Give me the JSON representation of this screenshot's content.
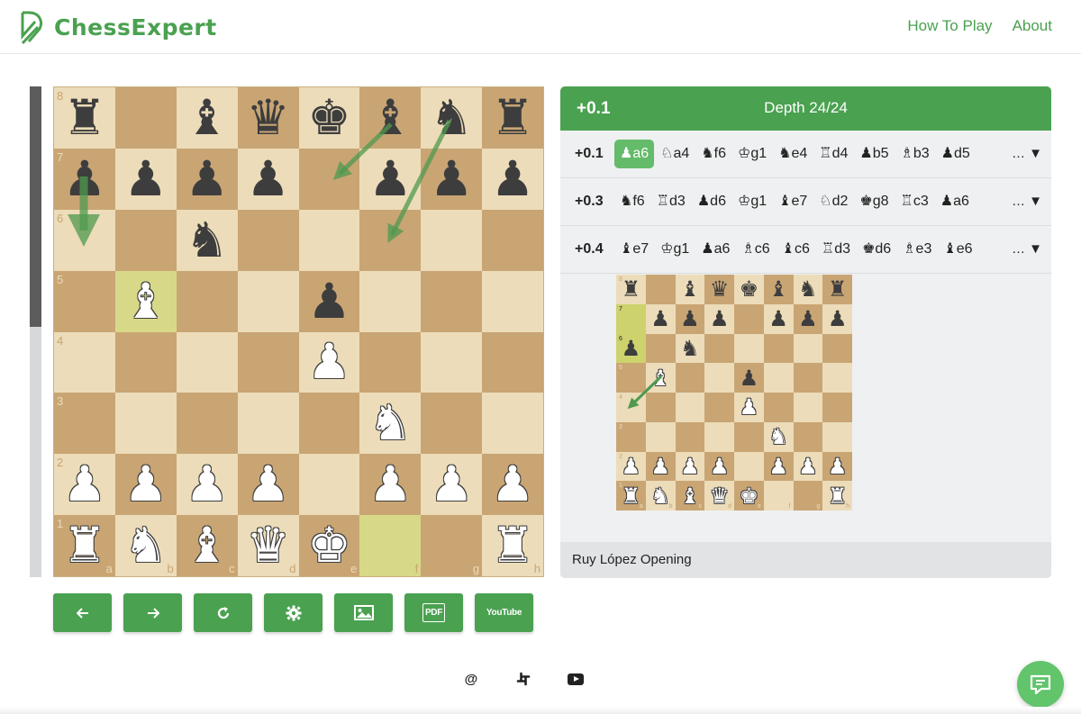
{
  "brand": {
    "name": "ChessExpert"
  },
  "nav": {
    "how_to_play": "How To Play",
    "about": "About"
  },
  "colors": {
    "accent": "#4aa150",
    "light_square": "#ecdcb9",
    "dark_square": "#c9a574",
    "highlight": "#d7d988"
  },
  "board": {
    "ranks": [
      "8",
      "7",
      "6",
      "5",
      "4",
      "3",
      "2",
      "1"
    ],
    "files": [
      "a",
      "b",
      "c",
      "d",
      "e",
      "f",
      "g",
      "h"
    ],
    "position": [
      [
        "r",
        "",
        "b",
        "q",
        "k",
        "b",
        "n",
        "r"
      ],
      [
        "p",
        "p",
        "p",
        "p",
        "",
        "p",
        "p",
        "p"
      ],
      [
        "",
        "",
        "n",
        "",
        "",
        "",
        "",
        ""
      ],
      [
        "",
        "B",
        "",
        "",
        "p",
        "",
        "",
        ""
      ],
      [
        "",
        "",
        "",
        "",
        "P",
        "",
        "",
        ""
      ],
      [
        "",
        "",
        "",
        "",
        "",
        "N",
        "",
        ""
      ],
      [
        "P",
        "P",
        "P",
        "P",
        "",
        "P",
        "P",
        "P"
      ],
      [
        "R",
        "N",
        "B",
        "Q",
        "K",
        "",
        "",
        "R"
      ]
    ],
    "highlighted": [
      "b5",
      "f1"
    ],
    "arrows": [
      {
        "from": "a7",
        "to": "a6"
      },
      {
        "from": "f8",
        "to": "e7"
      },
      {
        "from": "g8",
        "to": "f6"
      }
    ]
  },
  "eval_bar": {
    "white_fraction": 0.51
  },
  "controls": {
    "back": "back-arrow-icon",
    "forward": "forward-arrow-icon",
    "reset": "refresh-icon",
    "settings": "gear-icon",
    "image": "image-icon",
    "pdf_label": "PDF",
    "youtube_label": "YouTube"
  },
  "analysis": {
    "score": "+0.1",
    "depth": "Depth 24/24",
    "lines": [
      {
        "score": "+0.1",
        "moves": [
          "♟a6",
          "♘a4",
          "♞f6",
          "♔g1",
          "♞e4",
          "♖d4",
          "♟b5",
          "♗b3",
          "♟d5"
        ],
        "active": 0,
        "more": "… ▼"
      },
      {
        "score": "+0.3",
        "moves": [
          "♞f6",
          "♖d3",
          "♟d6",
          "♔g1",
          "♝e7",
          "♘d2",
          "♚g8",
          "♖c3",
          "♟a6"
        ],
        "active": -1,
        "more": "… ▼"
      },
      {
        "score": "+0.4",
        "moves": [
          "♝e7",
          "♔g1",
          "♟a6",
          "♗c6",
          "♝c6",
          "♖d3",
          "♚d6",
          "♗e3",
          "♝e6"
        ],
        "active": -1,
        "more": "… ▼"
      }
    ],
    "preview_position": [
      [
        "r",
        "",
        "b",
        "q",
        "k",
        "b",
        "n",
        "r"
      ],
      [
        "",
        "p",
        "p",
        "p",
        "",
        "p",
        "p",
        "p"
      ],
      [
        "p",
        "",
        "n",
        "",
        "",
        "",
        "",
        ""
      ],
      [
        "",
        "B",
        "",
        "",
        "p",
        "",
        "",
        ""
      ],
      [
        "",
        "",
        "",
        "",
        "P",
        "",
        "",
        ""
      ],
      [
        "",
        "",
        "",
        "",
        "",
        "N",
        "",
        ""
      ],
      [
        "P",
        "P",
        "P",
        "P",
        "",
        "P",
        "P",
        "P"
      ],
      [
        "R",
        "N",
        "B",
        "Q",
        "K",
        "",
        "",
        "R"
      ]
    ],
    "preview_highlighted": [
      "a7",
      "a6"
    ],
    "opening": "Ruy López Opening"
  },
  "footer": {
    "email_symbol": "@",
    "slack": "slack-icon",
    "youtube": "youtube-icon"
  }
}
